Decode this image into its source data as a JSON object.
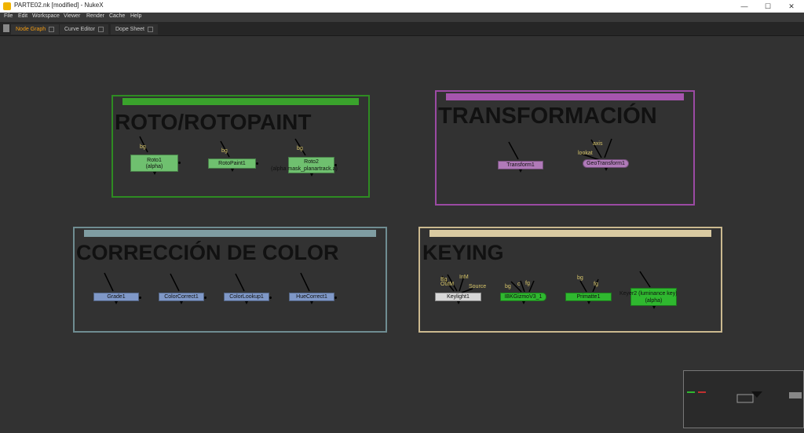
{
  "window": {
    "title": "PARTE02.nk [modified] - NukeX",
    "min": "—",
    "max": "☐",
    "close": "✕"
  },
  "menu": [
    "File",
    "Edit",
    "Workspace",
    "Viewer",
    "Render",
    "Cache",
    "Help"
  ],
  "tabs": [
    {
      "label": "Node Graph",
      "active": true
    },
    {
      "label": "Curve Editor",
      "active": false
    },
    {
      "label": "Dope Sheet",
      "active": false
    }
  ],
  "backdrops": {
    "roto": {
      "label": "ROTO/ROTOPAINT",
      "color": "#2e8b22",
      "bar": "#3aa32c"
    },
    "transform": {
      "label": "TRANSFORMACIÓN",
      "color": "#9b4aa3",
      "bar": "#a655ae"
    },
    "color": {
      "label": "CORRECCIÓN DE COLOR",
      "color": "#6f8d92",
      "bar": "#7f9da2"
    },
    "keying": {
      "label": "KEYING",
      "color": "#cbb98f",
      "bar": "#d9caa1"
    }
  },
  "nodes": {
    "roto1": {
      "line1": "Roto1",
      "line2": "(alpha)",
      "input": "bg"
    },
    "rotopaint1": {
      "line1": "RotoPaint1",
      "input": "bg"
    },
    "roto2": {
      "line1": "Roto2",
      "line2": "(alpha mask_planartrack.a)",
      "input": "bg"
    },
    "transform1": {
      "line1": "Transform1"
    },
    "geotransform1": {
      "line1": "GeoTransform1",
      "input_axis": "axis",
      "input_lookat": "lookat"
    },
    "grade1": {
      "line1": "Grade1"
    },
    "colorcorrect1": {
      "line1": "ColorCorrect1"
    },
    "colorlookup1": {
      "line1": "ColorLookup1"
    },
    "huecorrect1": {
      "line1": "HueCorrect1"
    },
    "keylight1": {
      "line1": "Keylight1",
      "input_bg": "Bg",
      "input_outm": "OutM",
      "input_inm": "InM",
      "input_source": "Source"
    },
    "ibkgizmo": {
      "line1": "IBKGizmoV3_1",
      "input_bg": "bg",
      "input_c": "c",
      "input_fg": "fg"
    },
    "primatte1": {
      "line1": "Primatte1",
      "input_bg": "bg",
      "input_fg": "fg"
    },
    "keyer2": {
      "line1": "Keyer2 (luminance key)",
      "line2": "(alpha)"
    }
  },
  "colors": {
    "roto_node": "#6fc06f",
    "transform_node": "#b07ab9",
    "color_node": "#7f98c8",
    "keylight_node": "#d8d8d8",
    "key_node": "#2fb82f"
  }
}
